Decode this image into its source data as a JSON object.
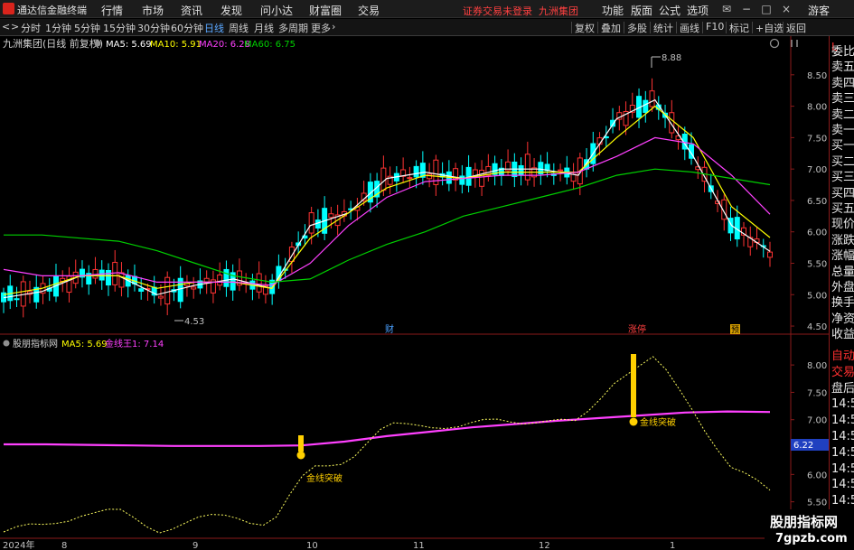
{
  "menubar": {
    "app_title": "通达信金融终端",
    "menus": [
      "行情",
      "市场",
      "资讯",
      "发现",
      "问小达",
      "财富圈",
      "交易"
    ],
    "login_status": "证券交易未登录",
    "stock_name_title": "九洲集团",
    "right_items": [
      "功能",
      "版面",
      "公式",
      "选项"
    ],
    "guest_label": "游客"
  },
  "toolbar": {
    "periods": [
      "分时",
      "1分钟",
      "5分钟",
      "15分钟",
      "30分钟",
      "60分钟",
      "日线",
      "周线",
      "月线",
      "多周期",
      "更多"
    ],
    "active_period": "日线",
    "right_items": [
      "复权",
      "叠加",
      "多股",
      "统计",
      "画线",
      "F10",
      "标记",
      "+自选",
      "返回"
    ]
  },
  "main_chart": {
    "legend_name": "九洲集团(日线 前复权)",
    "ma_labels": [
      "MA5: 5.69",
      "MA10: 5.91",
      "MA20: 6.28",
      "MA60: 6.75"
    ],
    "ma_colors": [
      "#ffffff",
      "#ffff00",
      "#ff40ff",
      "#00d000"
    ],
    "y_ticks": [
      "8.50",
      "8.00",
      "7.50",
      "7.00",
      "6.50",
      "6.00",
      "5.50",
      "5.00",
      "4.50"
    ],
    "high_label": "8.88",
    "low_label": "4.53",
    "event_labels": [
      "财",
      "涨停",
      "预"
    ],
    "top_right_tag": "L"
  },
  "sub_chart": {
    "legend_name": "股朋指标网",
    "legend_values": [
      "MA5: 5.69",
      "金线王1: 7.14"
    ],
    "y_ticks": [
      "8.00",
      "7.50",
      "7.00",
      "6.50",
      "6.00",
      "5.50",
      "5.00"
    ],
    "current_value": "6.22",
    "signal_label": "金线突破"
  },
  "x_axis": {
    "labels": [
      "2024年",
      "8",
      "9",
      "10",
      "11",
      "12",
      "1"
    ]
  },
  "right_panel": {
    "top_tag": "L",
    "items": [
      "委比",
      "卖五",
      "卖四",
      "卖三",
      "卖二",
      "卖一",
      "买一",
      "买二",
      "买三",
      "买四",
      "买五",
      "现价",
      "涨跌",
      "涨幅",
      "总量",
      "外盘",
      "换手",
      "净资",
      "收益",
      "自动",
      "交易",
      "盘后",
      "14:56",
      "14:56",
      "14:56",
      "14:56",
      "14:56",
      "14:56",
      "14:56",
      "14:56"
    ]
  },
  "watermark": {
    "line1": "股朋指标网",
    "line2": "7gpzb.com"
  },
  "chart_data": {
    "type": "line",
    "title": "九洲集团(日线 前复权)",
    "x_labels": [
      "2024年",
      "8",
      "9",
      "10",
      "11",
      "12",
      "1"
    ],
    "ylim": [
      4.4,
      8.9
    ],
    "series": [
      {
        "name": "MA5",
        "values": [
          4.95,
          5.05,
          5.3,
          5.3,
          5.0,
          5.15,
          5.25,
          5.1,
          6.1,
          6.3,
          6.85,
          6.95,
          6.85,
          7.0,
          7.0,
          6.9,
          7.8,
          8.1,
          7.2,
          6.1,
          5.69
        ]
      },
      {
        "name": "MA10",
        "values": [
          5.0,
          5.1,
          5.3,
          5.3,
          5.1,
          5.2,
          5.2,
          5.1,
          5.9,
          6.3,
          6.7,
          6.9,
          6.85,
          6.95,
          6.95,
          6.95,
          7.5,
          8.0,
          7.5,
          6.4,
          5.91
        ]
      },
      {
        "name": "MA20",
        "values": [
          5.4,
          5.3,
          5.3,
          5.35,
          5.2,
          5.2,
          5.2,
          5.15,
          5.5,
          6.1,
          6.55,
          6.8,
          6.85,
          6.9,
          6.9,
          6.95,
          7.2,
          7.5,
          7.4,
          6.9,
          6.28
        ]
      },
      {
        "name": "MA60",
        "values": [
          5.95,
          5.95,
          5.9,
          5.85,
          5.7,
          5.5,
          5.3,
          5.2,
          5.25,
          5.55,
          5.8,
          6.0,
          6.25,
          6.4,
          6.55,
          6.7,
          6.9,
          7.0,
          6.95,
          6.85,
          6.75
        ]
      }
    ]
  }
}
